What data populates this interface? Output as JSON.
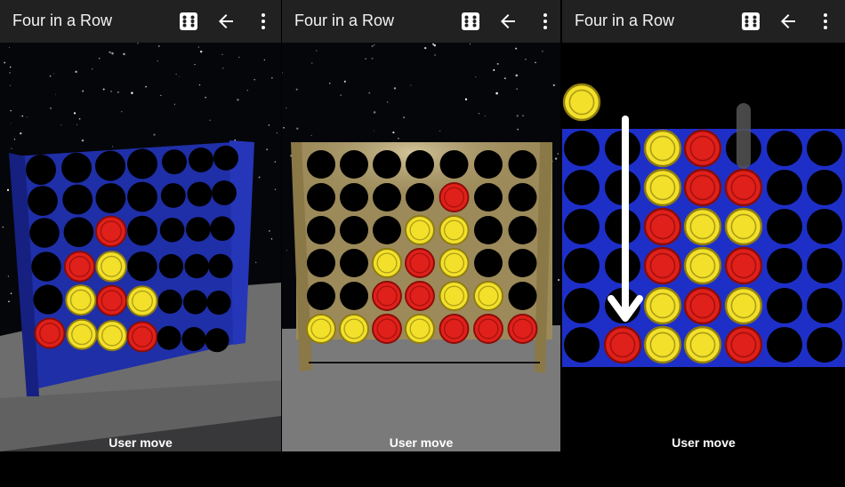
{
  "app_title": "Four in a Row",
  "status_text": "User move",
  "panels": [
    {
      "id": "blue-3d",
      "frame_color": "#1f2fa8"
    },
    {
      "id": "wood-3d",
      "frame_color": "#9c8a5a"
    },
    {
      "id": "flat-2d",
      "frame_color": "#1e2fc8"
    }
  ],
  "icons": [
    "dice-icon",
    "back-arrow-icon",
    "more-vert-icon"
  ],
  "colors": {
    "red_disc": "#e0201a",
    "yellow_disc": "#f2e02a",
    "empty_hole": "#000000",
    "toolbar": "#212121"
  },
  "boards": {
    "blue_3d": [
      [
        "E",
        "E",
        "E",
        "E",
        "E",
        "E",
        "E"
      ],
      [
        "E",
        "E",
        "E",
        "E",
        "E",
        "E",
        "E"
      ],
      [
        "E",
        "E",
        "R",
        "E",
        "E",
        "E",
        "E"
      ],
      [
        "E",
        "R",
        "Y",
        "E",
        "E",
        "E",
        "E"
      ],
      [
        "E",
        "Y",
        "R",
        "Y",
        "E",
        "E",
        "E"
      ],
      [
        "R",
        "Y",
        "Y",
        "R",
        "E",
        "E",
        "E"
      ]
    ],
    "wood_3d": [
      [
        "E",
        "E",
        "E",
        "E",
        "E",
        "E",
        "E"
      ],
      [
        "E",
        "E",
        "E",
        "E",
        "R",
        "E",
        "E"
      ],
      [
        "E",
        "E",
        "E",
        "Y",
        "Y",
        "E",
        "E"
      ],
      [
        "E",
        "E",
        "Y",
        "R",
        "Y",
        "E",
        "E"
      ],
      [
        "E",
        "E",
        "R",
        "R",
        "Y",
        "Y",
        "E"
      ],
      [
        "Y",
        "Y",
        "R",
        "Y",
        "R",
        "R",
        "R"
      ]
    ],
    "flat_2d": [
      [
        "E",
        "E",
        "Y",
        "R",
        "E",
        "E",
        "E"
      ],
      [
        "E",
        "E",
        "Y",
        "R",
        "R",
        "E",
        "E"
      ],
      [
        "E",
        "E",
        "R",
        "Y",
        "Y",
        "E",
        "E"
      ],
      [
        "E",
        "E",
        "R",
        "Y",
        "R",
        "E",
        "E"
      ],
      [
        "E",
        "E",
        "Y",
        "R",
        "Y",
        "E",
        "E"
      ],
      [
        "E",
        "R",
        "Y",
        "Y",
        "R",
        "E",
        "E"
      ]
    ],
    "flat_2d_pending": "Y"
  }
}
